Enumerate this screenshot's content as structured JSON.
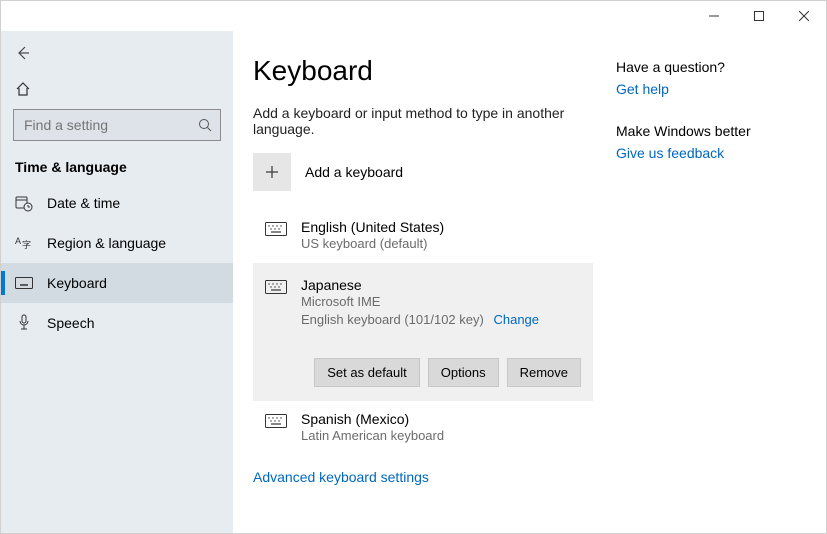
{
  "searchPlaceholder": "Find a setting",
  "sectionHeader": "Time & language",
  "nav": [
    {
      "label": "Date & time"
    },
    {
      "label": "Region & language"
    },
    {
      "label": "Keyboard"
    },
    {
      "label": "Speech"
    }
  ],
  "page": {
    "title": "Keyboard",
    "subtitle": "Add a keyboard or input method to type in another language.",
    "addLabel": "Add a keyboard",
    "advancedLink": "Advanced keyboard settings"
  },
  "keyboards": [
    {
      "title": "English (United States)",
      "sub1": "US keyboard (default)"
    },
    {
      "title": "Japanese",
      "sub1": "Microsoft IME",
      "sub2": "English keyboard (101/102 key)",
      "changeLabel": "Change"
    },
    {
      "title": "Spanish (Mexico)",
      "sub1": "Latin American keyboard"
    }
  ],
  "buttons": {
    "setDefault": "Set as default",
    "options": "Options",
    "remove": "Remove"
  },
  "aside": {
    "q1": "Have a question?",
    "getHelp": "Get help",
    "q2": "Make Windows better",
    "feedback": "Give us feedback"
  }
}
